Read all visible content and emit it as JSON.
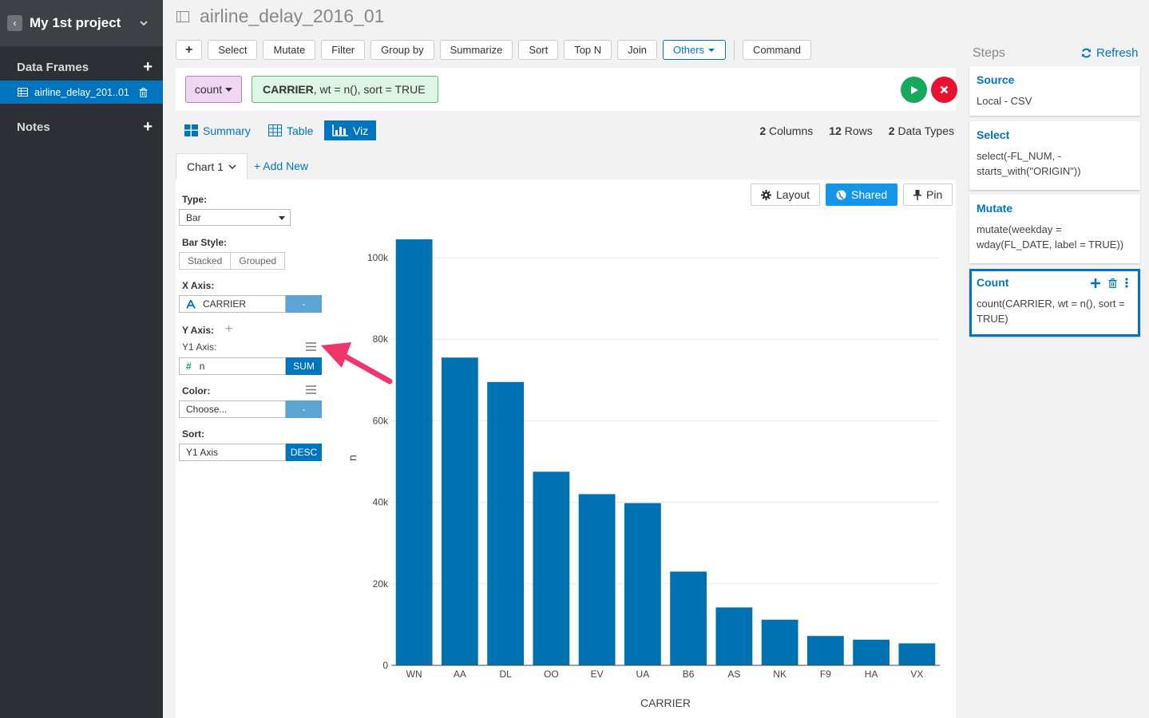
{
  "sidebar": {
    "project_title": "My 1st project",
    "data_frames_label": "Data Frames",
    "data_frame_item": "airline_delay_201..01",
    "notes_label": "Notes"
  },
  "header": {
    "title": "airline_delay_2016_01"
  },
  "toolbar": {
    "add_label": "+",
    "buttons": [
      "Select",
      "Mutate",
      "Filter",
      "Group by",
      "Summarize",
      "Sort",
      "Top N",
      "Join"
    ],
    "others_label": "Others",
    "command_label": "Command"
  },
  "command": {
    "verb": "count",
    "expr_bold": "CARRIER",
    "expr_rest": ", wt = n(), sort = TRUE"
  },
  "views": {
    "summary": "Summary",
    "table": "Table",
    "viz": "Viz"
  },
  "stats": {
    "columns_num": "2",
    "columns_label": "Columns",
    "rows_num": "12",
    "rows_label": "Rows",
    "types_num": "2",
    "types_label": "Data Types"
  },
  "chart_tab": {
    "label": "Chart 1",
    "add_new": "+ Add New"
  },
  "panel": {
    "type_label": "Type:",
    "type_value": "Bar",
    "bar_style_label": "Bar Style:",
    "bar_style_options": [
      "Stacked",
      "Grouped"
    ],
    "x_axis_label": "X Axis:",
    "x_axis_field": "CARRIER",
    "x_axis_btn": "-",
    "y_axis_label": "Y Axis:",
    "y_axis_add": "+",
    "y1_axis_label": "Y1 Axis:",
    "y1_field": "n",
    "y1_btn": "SUM",
    "color_label": "Color:",
    "color_value": "Choose...",
    "color_btn": "-",
    "sort_label": "Sort:",
    "sort_value": "Y1 Axis",
    "sort_btn": "DESC",
    "layout_btn": "Layout",
    "shared_btn": "Shared",
    "pin_btn": "Pin"
  },
  "chart_data": {
    "type": "bar",
    "categories": [
      "WN",
      "AA",
      "DL",
      "OO",
      "EV",
      "UA",
      "B6",
      "AS",
      "NK",
      "F9",
      "HA",
      "VX"
    ],
    "values": [
      104500,
      75500,
      69500,
      47500,
      42000,
      39800,
      23000,
      14200,
      11200,
      7200,
      6300,
      5400
    ],
    "xlabel": "CARRIER",
    "ylabel": "n",
    "ylim": [
      0,
      104500
    ],
    "yticks": [
      0,
      20000,
      40000,
      60000,
      80000,
      100000
    ],
    "ytick_labels": [
      "0",
      "20k",
      "40k",
      "60k",
      "80k",
      "100k"
    ],
    "grid": true,
    "bar_color": "#0072b2"
  },
  "steps": {
    "title": "Steps",
    "refresh": "Refresh",
    "items": [
      {
        "title": "Source",
        "body": "Local - CSV"
      },
      {
        "title": "Select",
        "body": "select(-FL_NUM, -starts_with(\"ORIGIN\"))"
      },
      {
        "title": "Mutate",
        "body": "mutate(weekday = wday(FL_DATE, label = TRUE))"
      },
      {
        "title": "Count",
        "body": "count(CARRIER, wt = n(), sort = TRUE)"
      }
    ]
  },
  "colors": {
    "accent": "#0075bf",
    "sidebar_bg": "#2c2f33",
    "run": "#16a85c",
    "cancel": "#e8112f",
    "annotation_arrow": "#f0356b"
  }
}
